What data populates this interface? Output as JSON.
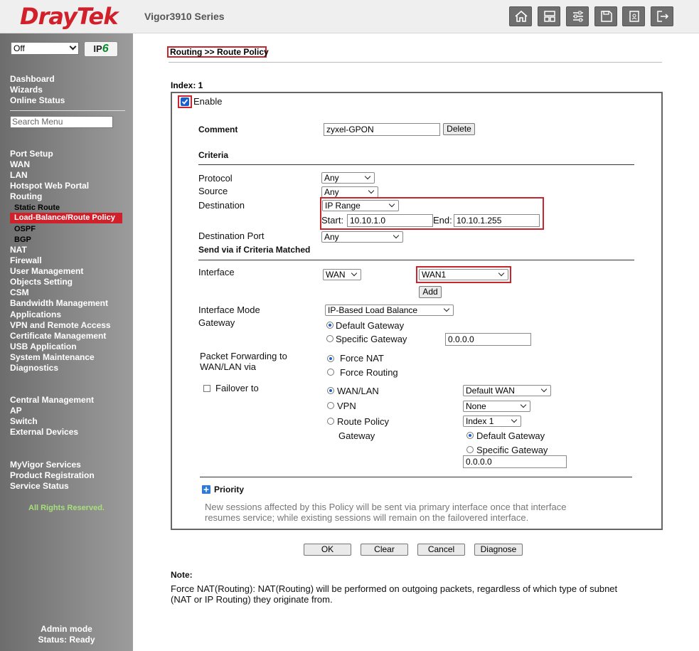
{
  "header": {
    "logo_part1": "Dray",
    "logo_part2": "Tek",
    "model": "Vigor3910 Series",
    "icons": [
      "home-icon",
      "dashboard-icon",
      "sliders-icon",
      "save-icon",
      "contacts-icon",
      "logout-icon"
    ]
  },
  "sidebar": {
    "mode_select": "Off",
    "ipv6_label": "IP",
    "ipv6_num": "6",
    "top_items": [
      "Dashboard",
      "Wizards",
      "Online Status"
    ],
    "search_placeholder": "Search Menu",
    "menu": [
      {
        "label": "Port Setup"
      },
      {
        "label": "WAN"
      },
      {
        "label": "LAN"
      },
      {
        "label": "Hotspot Web Portal"
      },
      {
        "label": "Routing"
      }
    ],
    "routing_sub": [
      "Static Route",
      "Load-Balance/Route Policy",
      "OSPF",
      "BGP"
    ],
    "menu2": [
      "NAT",
      "Firewall",
      "User Management",
      "Objects Setting",
      "CSM",
      "Bandwidth Management",
      "Applications",
      "VPN and Remote Access",
      "Certificate Management",
      "USB Application",
      "System Maintenance",
      "Diagnostics"
    ],
    "menu3": [
      "Central Management",
      "AP",
      "Switch",
      "External Devices"
    ],
    "menu4": [
      "MyVigor Services",
      "Product Registration",
      "Service Status"
    ],
    "rights": "All Rights Reserved.",
    "admin_mode": "Admin mode",
    "status": "Status: Ready"
  },
  "main": {
    "breadcrumb": "Routing >> Route Policy",
    "index_label": "Index: 1",
    "enable_label": "Enable",
    "comment_label": "Comment",
    "comment_value": "zyxel-GPON",
    "delete_btn": "Delete",
    "criteria_title": "Criteria",
    "protocol_label": "Protocol",
    "protocol_value": "Any",
    "source_label": "Source",
    "source_value": "Any",
    "destination_label": "Destination",
    "destination_value": "IP Range",
    "start_label": "Start:",
    "start_value": "10.10.1.0",
    "end_label": "End:",
    "end_value": "10.10.1.255",
    "dest_port_label": "Destination Port",
    "dest_port_value": "Any",
    "send_via_title": "Send via if Criteria Matched",
    "interface_label": "Interface",
    "interface_type": "WAN",
    "interface_value": "WAN1",
    "add_btn": "Add",
    "mode_label": "Interface Mode",
    "mode_value": "IP-Based Load Balance",
    "gateway_label": "Gateway",
    "default_gateway": "Default Gateway",
    "specific_gateway": "Specific Gateway",
    "gateway_ip": "0.0.0.0",
    "pkt_fwd_label1": "Packet Forwarding to",
    "pkt_fwd_label2": "WAN/LAN via",
    "force_nat": "Force NAT",
    "force_routing": "Force Routing",
    "failover_label": "Failover to",
    "fo_wanlan": "WAN/LAN",
    "fo_wanlan_value": "Default WAN",
    "fo_vpn": "VPN",
    "fo_vpn_value": "None",
    "fo_route_policy": "Route Policy",
    "fo_route_policy_value": "Index 1",
    "fo_gateway": "Gateway",
    "fo_default_gateway": "Default Gateway",
    "fo_specific_gateway": "Specific Gateway",
    "fo_gateway_ip": "0.0.0.0",
    "priority_title": "Priority",
    "priority_text1": "New sessions affected by this Policy will be sent via primary interface once that interface",
    "priority_text2": "resumes service; while existing sessions will remain on the failovered interface.",
    "ok_btn": "OK",
    "clear_btn": "Clear",
    "cancel_btn": "Cancel",
    "diagnose_btn": "Diagnose",
    "note_title": "Note:",
    "note_text1": "Force NAT(Routing): NAT(Routing) will be performed on outgoing packets, regardless of which type of subnet",
    "note_text2": "(NAT or IP Routing) they originate from."
  }
}
